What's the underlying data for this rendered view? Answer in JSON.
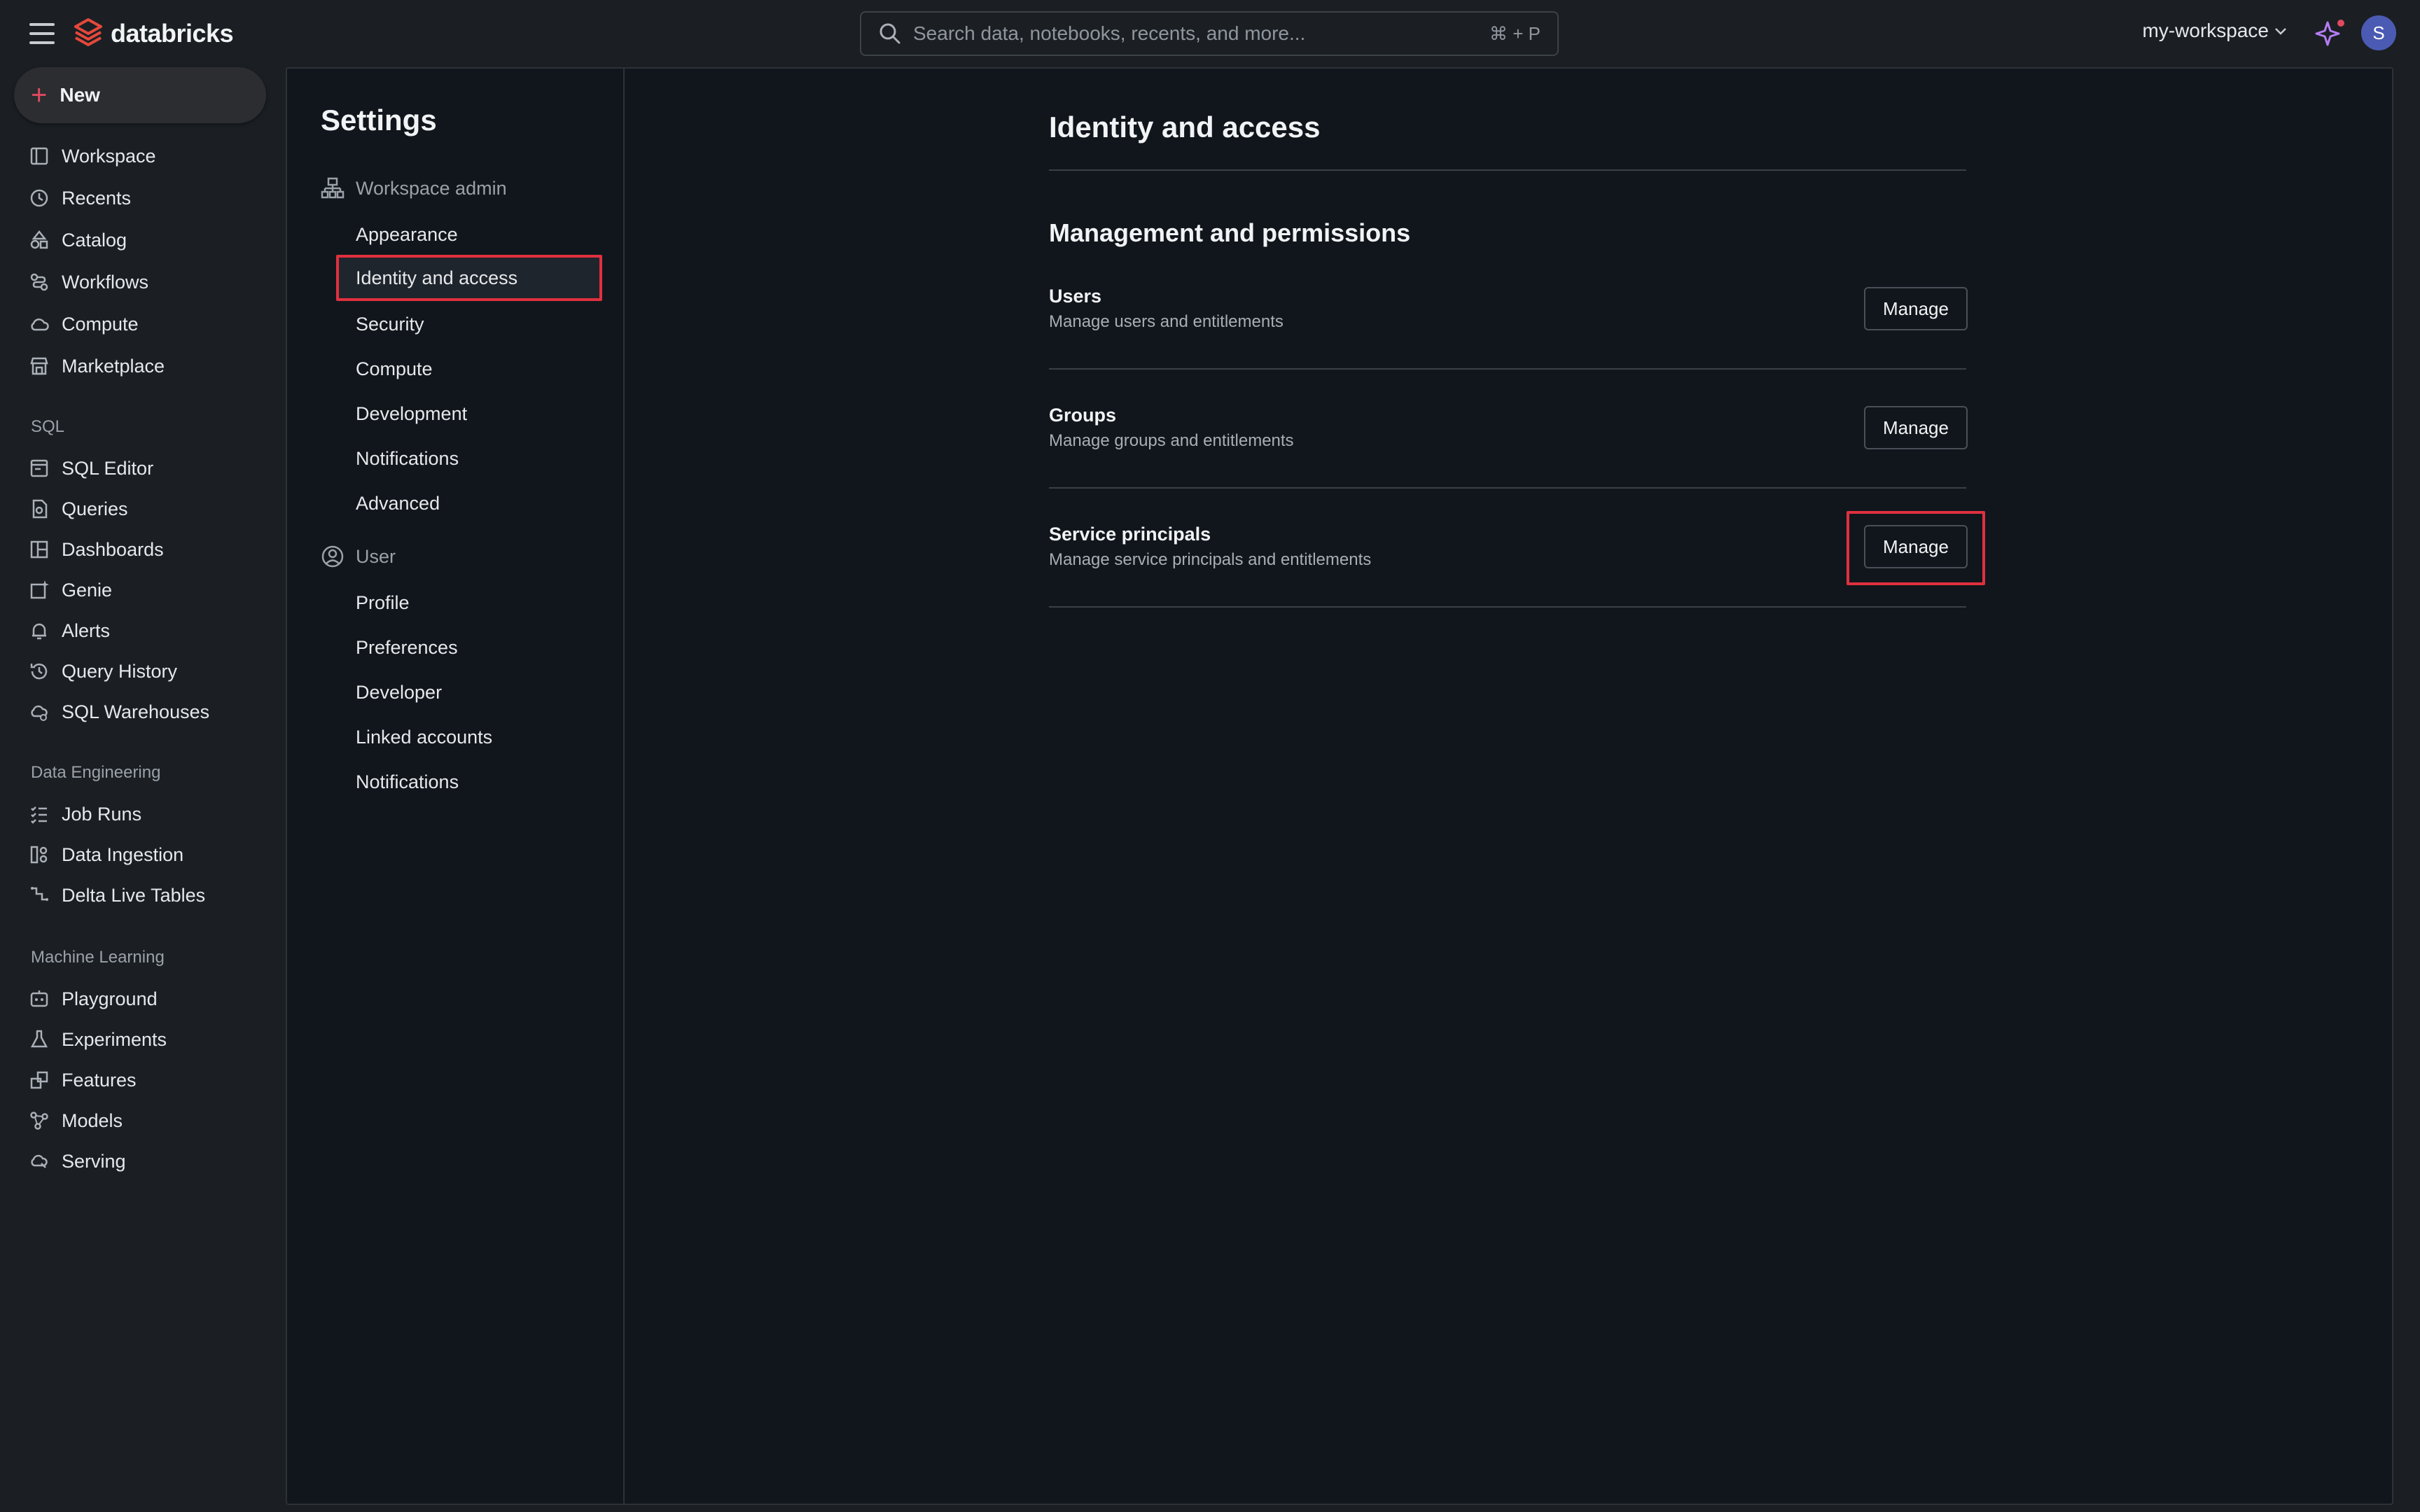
{
  "topbar": {
    "brand": "databricks",
    "search_placeholder": "Search data, notebooks, recents, and more...",
    "search_shortcut": "⌘ + P",
    "workspace": "my-workspace",
    "avatar_initial": "S"
  },
  "sidebar": {
    "new_label": "New",
    "items": [
      {
        "label": "Workspace",
        "icon": "workspace-icon"
      },
      {
        "label": "Recents",
        "icon": "clock-icon"
      },
      {
        "label": "Catalog",
        "icon": "catalog-icon"
      },
      {
        "label": "Workflows",
        "icon": "workflows-icon"
      },
      {
        "label": "Compute",
        "icon": "cloud-icon"
      },
      {
        "label": "Marketplace",
        "icon": "store-icon"
      }
    ],
    "sql_section": "SQL",
    "sql_items": [
      {
        "label": "SQL Editor",
        "icon": "sql-editor-icon"
      },
      {
        "label": "Queries",
        "icon": "queries-icon"
      },
      {
        "label": "Dashboards",
        "icon": "dashboard-icon"
      },
      {
        "label": "Genie",
        "icon": "genie-icon"
      },
      {
        "label": "Alerts",
        "icon": "bell-icon"
      },
      {
        "label": "Query History",
        "icon": "history-icon"
      },
      {
        "label": "SQL Warehouses",
        "icon": "warehouse-icon"
      }
    ],
    "de_section": "Data Engineering",
    "de_items": [
      {
        "label": "Job Runs",
        "icon": "job-runs-icon"
      },
      {
        "label": "Data Ingestion",
        "icon": "ingestion-icon"
      },
      {
        "label": "Delta Live Tables",
        "icon": "pipeline-icon"
      }
    ],
    "ml_section": "Machine Learning",
    "ml_items": [
      {
        "label": "Playground",
        "icon": "playground-icon"
      },
      {
        "label": "Experiments",
        "icon": "flask-icon"
      },
      {
        "label": "Features",
        "icon": "features-icon"
      },
      {
        "label": "Models",
        "icon": "models-icon"
      },
      {
        "label": "Serving",
        "icon": "serving-icon"
      }
    ]
  },
  "settings": {
    "title": "Settings",
    "workspace_admin": "Workspace admin",
    "admin_items": [
      "Appearance",
      "Identity and access",
      "Security",
      "Compute",
      "Development",
      "Notifications",
      "Advanced"
    ],
    "user": "User",
    "user_items": [
      "Profile",
      "Preferences",
      "Developer",
      "Linked accounts",
      "Notifications"
    ]
  },
  "main": {
    "title": "Identity and access",
    "section": "Management and permissions",
    "rows": [
      {
        "title": "Users",
        "desc": "Manage users and entitlements",
        "button": "Manage"
      },
      {
        "title": "Groups",
        "desc": "Manage groups and entitlements",
        "button": "Manage"
      },
      {
        "title": "Service principals",
        "desc": "Manage service principals and entitlements",
        "button": "Manage"
      }
    ]
  },
  "colors": {
    "accent": "#e0303f",
    "brand": "#e04a3a"
  }
}
